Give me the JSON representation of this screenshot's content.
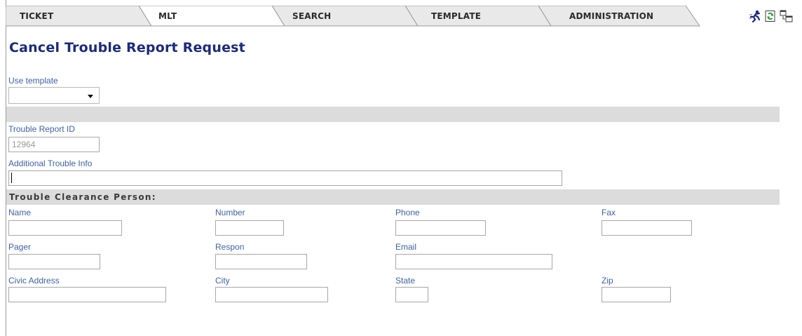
{
  "nav": {
    "tabs": [
      {
        "label": "TICKET"
      },
      {
        "label": "MLT"
      },
      {
        "label": "SEARCH"
      },
      {
        "label": "TEMPLATE"
      },
      {
        "label": "ADMINISTRATION"
      }
    ],
    "tools": [
      {
        "icon": "running-man-icon"
      },
      {
        "icon": "refresh-document-icon"
      },
      {
        "icon": "window-switch-icon"
      }
    ]
  },
  "page": {
    "title": "Cancel Trouble Report Request"
  },
  "template": {
    "label": "Use template",
    "value": ""
  },
  "report": {
    "id_label": "Trouble Report ID",
    "id_value": "12964",
    "info_label": "Additional Trouble Info",
    "info_value": ""
  },
  "clearance": {
    "section_title": "Trouble Clearance Person:",
    "name_label": "Name",
    "number_label": "Number",
    "phone_label": "Phone",
    "fax_label": "Fax",
    "pager_label": "Pager",
    "respon_label": "Respon",
    "email_label": "Email",
    "civic_label": "Civic Address",
    "city_label": "City",
    "state_label": "State",
    "zip_label": "Zip"
  },
  "colors": {
    "title": "#1a2a80",
    "label": "#3e62a6",
    "band": "#dcdcdc"
  }
}
